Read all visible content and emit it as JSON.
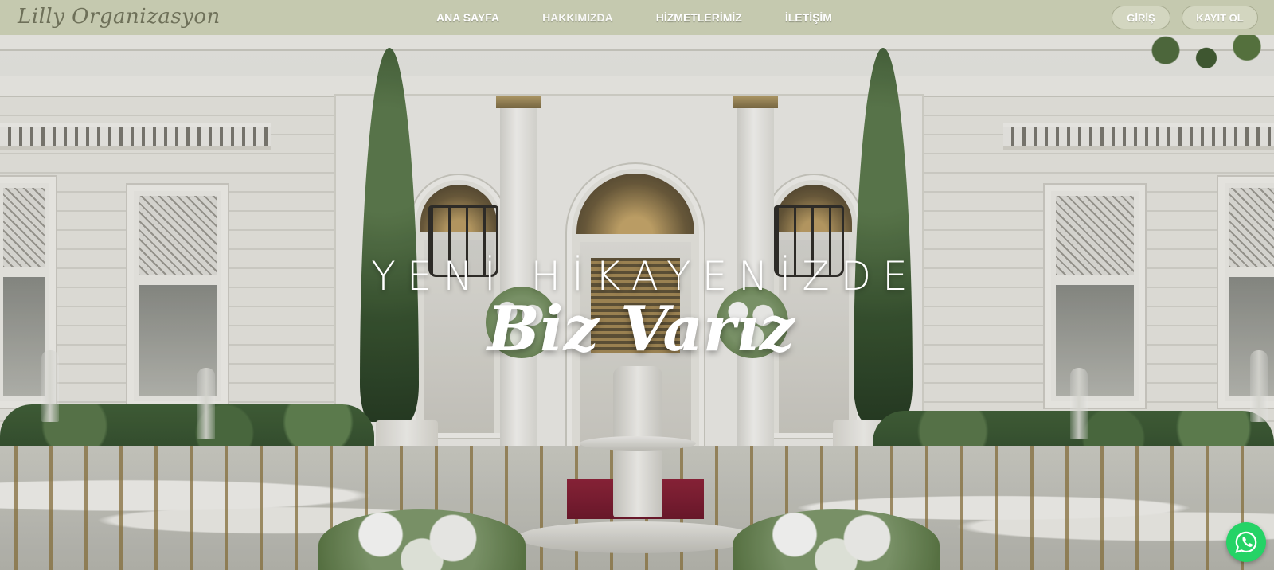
{
  "brand": {
    "logo_text": "Lilly Organizasyon"
  },
  "nav": {
    "items": [
      {
        "label": "ANA SAYFA"
      },
      {
        "label": "HAKKIMIZDA"
      },
      {
        "label": "HİZMETLERİMİZ"
      },
      {
        "label": "İLETİŞİM"
      }
    ],
    "login_label": "GİRİŞ",
    "register_label": "KAYIT OL"
  },
  "hero": {
    "line1": "YENİ HİKAYENİZDE",
    "line2": "Biz Varız"
  },
  "widgets": {
    "chat_icon": "whatsapp-icon"
  },
  "colors": {
    "navbar_bg": "#c5c9af",
    "logo_text": "#6e7059",
    "whatsapp_green": "#25d366"
  }
}
